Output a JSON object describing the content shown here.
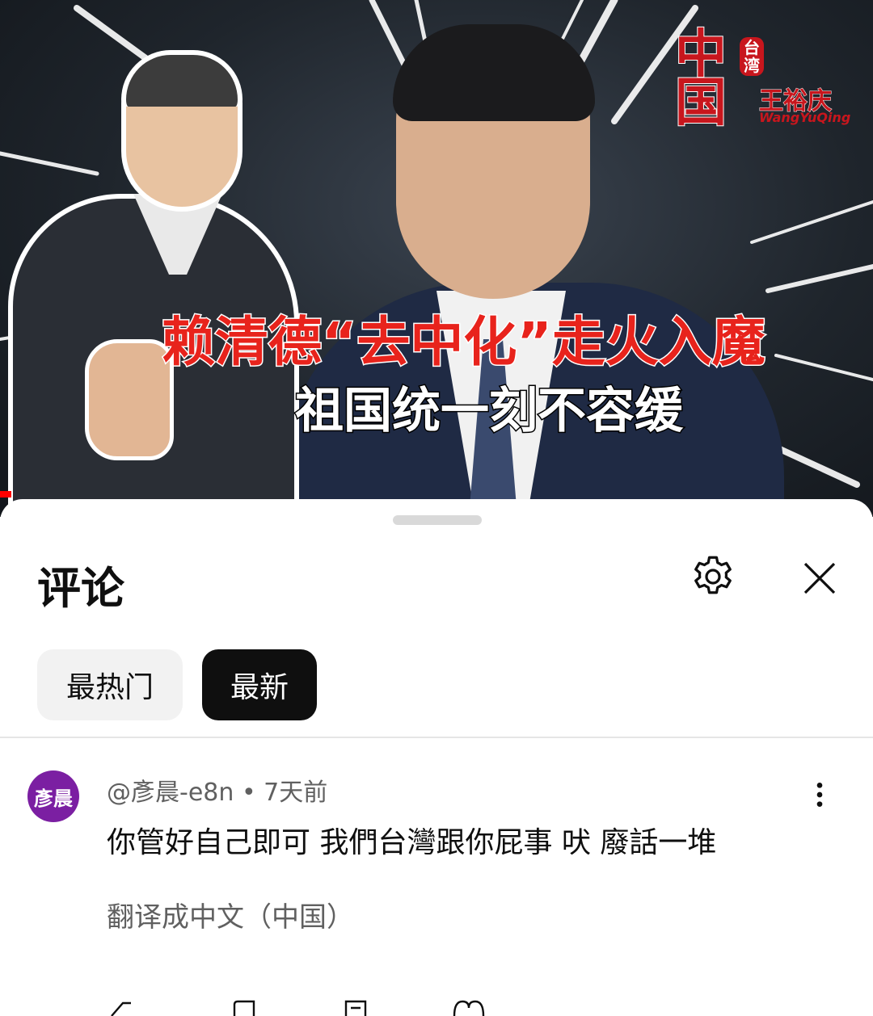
{
  "video": {
    "headline": "赖清德“去中化”走火入魔",
    "subline": "祖国统一刻不容缓",
    "logo": {
      "big": "中国",
      "small": "台湾",
      "name": "王裕庆",
      "roman": "WangYuQing"
    }
  },
  "comments_panel": {
    "title": "评论",
    "settings_icon": "gear-icon",
    "close_icon": "close-icon",
    "sort_chips": [
      {
        "label": "最热门",
        "selected": false
      },
      {
        "label": "最新",
        "selected": true
      }
    ],
    "comments": [
      {
        "avatar_text": "彥晨",
        "avatar_color": "#7b1fa2",
        "author": "@彥晨-e8n",
        "time": "7天前",
        "text": "你管好自己即可  我們台灣跟你屁事 吠 廢話一堆",
        "translate_label": "翻译成中文（中国）"
      }
    ]
  },
  "colors": {
    "accent_red": "#ff0000",
    "selected_chip": "#0f0f0f",
    "chip_bg": "#f2f2f2"
  }
}
